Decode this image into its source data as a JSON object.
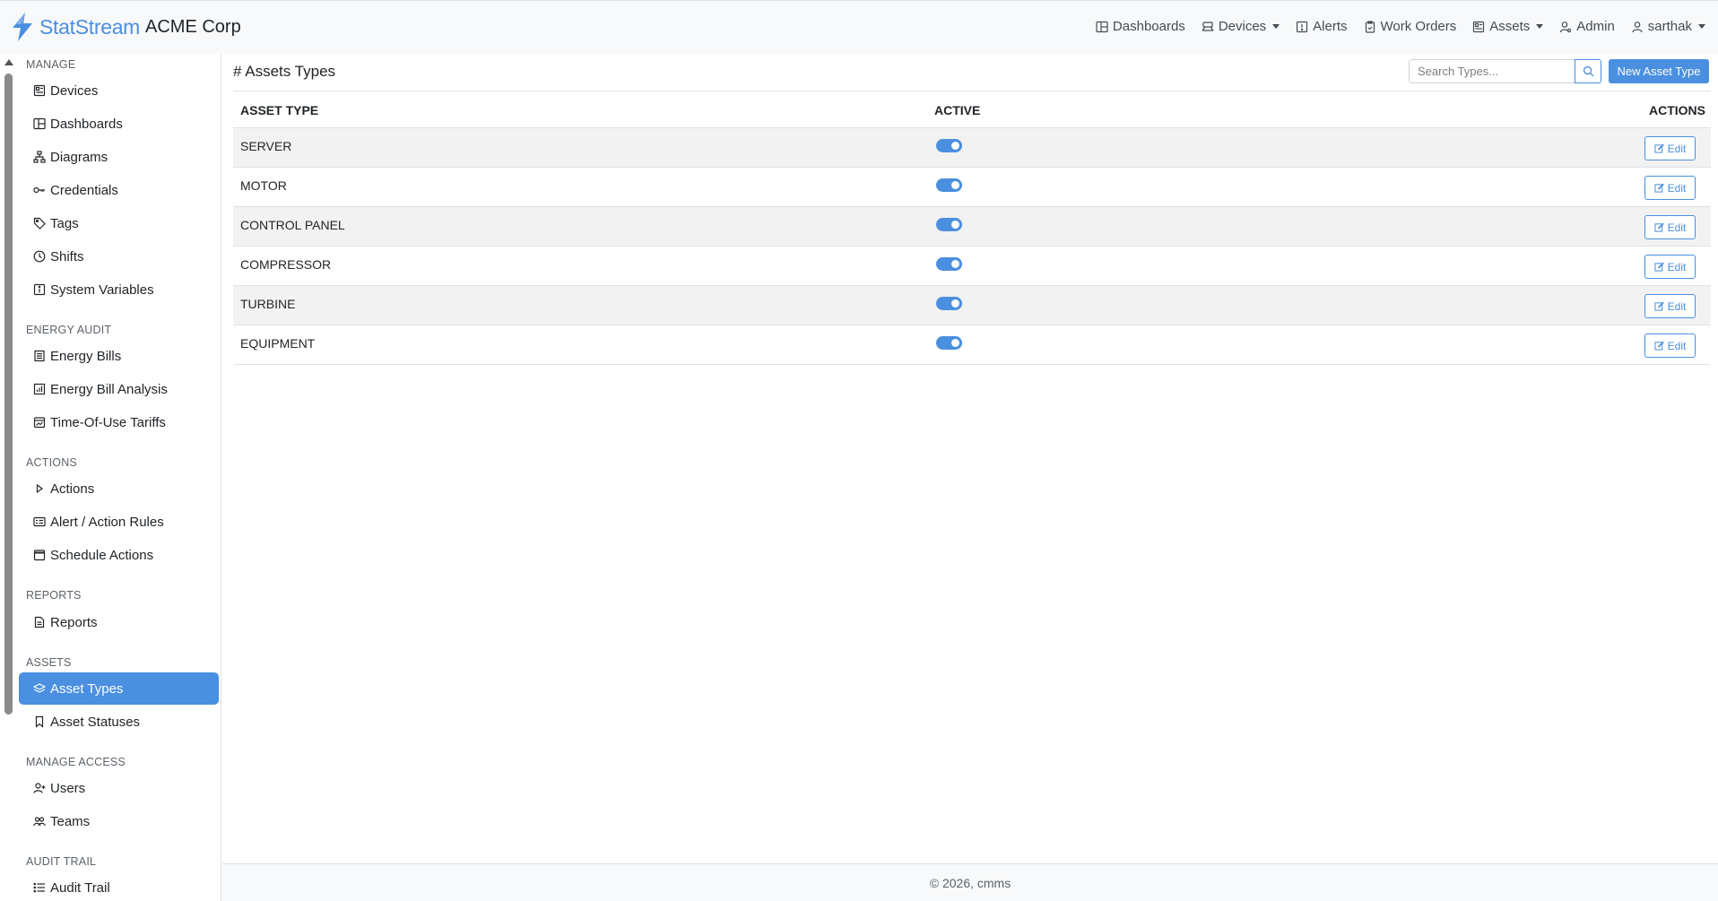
{
  "brand": {
    "name": "StatStream",
    "org": "ACME Corp",
    "logo_color": "#4a8fe0"
  },
  "topnav": {
    "items": [
      {
        "label": "Dashboards",
        "icon": "layout-icon",
        "dropdown": false
      },
      {
        "label": "Devices",
        "icon": "devices-icon",
        "dropdown": true
      },
      {
        "label": "Alerts",
        "icon": "alert-icon",
        "dropdown": false
      },
      {
        "label": "Work Orders",
        "icon": "clipboard-icon",
        "dropdown": false
      },
      {
        "label": "Assets",
        "icon": "assets-icon",
        "dropdown": true
      },
      {
        "label": "Admin",
        "icon": "admin-icon",
        "dropdown": false
      },
      {
        "label": "sarthak",
        "icon": "user-icon",
        "dropdown": true
      }
    ]
  },
  "sidebar": {
    "sections": [
      {
        "title": "MANAGE",
        "items": [
          {
            "label": "Devices",
            "icon": "devices-icon"
          },
          {
            "label": "Dashboards",
            "icon": "layout-icon"
          },
          {
            "label": "Diagrams",
            "icon": "diagram-icon"
          },
          {
            "label": "Credentials",
            "icon": "key-icon"
          },
          {
            "label": "Tags",
            "icon": "tag-icon"
          },
          {
            "label": "Shifts",
            "icon": "clock-icon"
          },
          {
            "label": "System Variables",
            "icon": "info-icon"
          }
        ]
      },
      {
        "title": "ENERGY AUDIT",
        "items": [
          {
            "label": "Energy Bills",
            "icon": "receipt-icon"
          },
          {
            "label": "Energy Bill Analysis",
            "icon": "chart-icon"
          },
          {
            "label": "Time-Of-Use Tariffs",
            "icon": "calendar-chart-icon"
          }
        ]
      },
      {
        "title": "ACTIONS",
        "items": [
          {
            "label": "Actions",
            "icon": "play-icon"
          },
          {
            "label": "Alert / Action Rules",
            "icon": "rules-icon"
          },
          {
            "label": "Schedule Actions",
            "icon": "calendar-icon"
          }
        ]
      },
      {
        "title": "REPORTS",
        "items": [
          {
            "label": "Reports",
            "icon": "report-icon"
          }
        ]
      },
      {
        "title": "ASSETS",
        "items": [
          {
            "label": "Asset Types",
            "icon": "layers-icon",
            "active": true
          },
          {
            "label": "Asset Statuses",
            "icon": "bookmark-icon"
          }
        ]
      },
      {
        "title": "MANAGE ACCESS",
        "items": [
          {
            "label": "Users",
            "icon": "user-plus-icon"
          },
          {
            "label": "Teams",
            "icon": "team-icon"
          }
        ]
      },
      {
        "title": "AUDIT TRAIL",
        "items": [
          {
            "label": "Audit Trail",
            "icon": "list-icon"
          }
        ]
      }
    ]
  },
  "page": {
    "title": "# Assets Types",
    "search_placeholder": "Search Types...",
    "new_button": "New Asset Type"
  },
  "table": {
    "headers": {
      "type": "ASSET TYPE",
      "active": "ACTIVE",
      "actions": "ACTIONS"
    },
    "rows": [
      {
        "name": "SERVER",
        "active": true,
        "action": "Edit"
      },
      {
        "name": "MOTOR",
        "active": true,
        "action": "Edit"
      },
      {
        "name": "CONTROL PANEL",
        "active": true,
        "action": "Edit"
      },
      {
        "name": "COMPRESSOR",
        "active": true,
        "action": "Edit"
      },
      {
        "name": "TURBINE",
        "active": true,
        "action": "Edit"
      },
      {
        "name": "EQUIPMENT",
        "active": true,
        "action": "Edit"
      }
    ]
  },
  "footer": {
    "text": "© 2026, cmms"
  }
}
